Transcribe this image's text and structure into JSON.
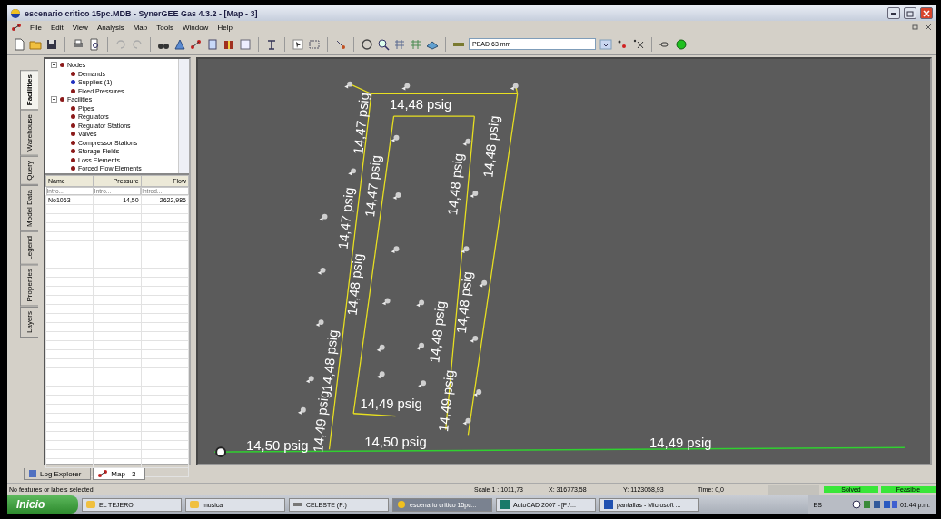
{
  "window": {
    "title": "escenario critico 15pc.MDB - SynerGEE Gas 4.3.2 - [Map - 3]"
  },
  "menu": [
    "File",
    "Edit",
    "View",
    "Analysis",
    "Map",
    "Tools",
    "Window",
    "Help"
  ],
  "toolbar": {
    "pipe_dropdown": "PEAD 63 mm"
  },
  "side_tabs": [
    {
      "label": "Facilities",
      "selected": true
    },
    {
      "label": "Warehouse",
      "selected": false
    },
    {
      "label": "Query",
      "selected": false
    },
    {
      "label": "Model Data",
      "selected": false
    },
    {
      "label": "Legend",
      "selected": false
    },
    {
      "label": "Properties",
      "selected": false
    },
    {
      "label": "Layers",
      "selected": false
    }
  ],
  "tree": [
    {
      "label": "Nodes",
      "color": "#8b1a1a",
      "expanded": true,
      "children": [
        {
          "label": "Demands",
          "color": "#8b1a1a"
        },
        {
          "label": "Supplies (1)",
          "color": "#2030c0"
        },
        {
          "label": "Fixed Pressures",
          "color": "#8b1a1a"
        }
      ]
    },
    {
      "label": "Facilities",
      "color": "#8b1a1a",
      "expanded": true,
      "children": [
        {
          "label": "Pipes",
          "color": "#8b1a1a"
        },
        {
          "label": "Regulators",
          "color": "#8b1a1a"
        },
        {
          "label": "Regulator Stations",
          "color": "#8b1a1a"
        },
        {
          "label": "Valves",
          "color": "#8b1a1a"
        },
        {
          "label": "Compressor Stations",
          "color": "#8b1a1a"
        },
        {
          "label": "Storage Fields",
          "color": "#8b1a1a"
        },
        {
          "label": "Loss Elements",
          "color": "#8b1a1a"
        },
        {
          "label": "Forced Flow Elements",
          "color": "#8b1a1a"
        }
      ]
    }
  ],
  "grid": {
    "columns": [
      {
        "label": "Name",
        "placeholder": "Intro..."
      },
      {
        "label": "Pressure",
        "placeholder": "Intro..."
      },
      {
        "label": "Flow",
        "placeholder": "Introd..."
      }
    ],
    "rows": [
      [
        "No1063",
        "14,50",
        "2622,986"
      ]
    ]
  },
  "map_labels": [
    {
      "text": "14,47 psig",
      "kind": "vertical"
    },
    {
      "text": "14,48 psig",
      "kind": "horizontal"
    },
    {
      "text": "14,47 psig",
      "kind": "vertical"
    },
    {
      "text": "14,48 psig",
      "kind": "vertical"
    },
    {
      "text": "14,48 psig",
      "kind": "vertical"
    },
    {
      "text": "14,47 psig",
      "kind": "vertical"
    },
    {
      "text": "14,48 psig",
      "kind": "vertical"
    },
    {
      "text": "14,48 psig",
      "kind": "vertical"
    },
    {
      "text": "14,48 psig",
      "kind": "vertical"
    },
    {
      "text": "14,48 psig",
      "kind": "vertical"
    },
    {
      "text": "14,49 psig",
      "kind": "horizontal"
    },
    {
      "text": "14,49 psig",
      "kind": "vertical"
    },
    {
      "text": "14,49 psig",
      "kind": "vertical"
    },
    {
      "text": "14,50 psig",
      "kind": "horizontal"
    },
    {
      "text": "14,50 psig",
      "kind": "horizontal"
    },
    {
      "text": "14,49 psig",
      "kind": "horizontal"
    }
  ],
  "bottom_tabs": [
    {
      "label": "Log Explorer",
      "selected": false
    },
    {
      "label": "Map - 3",
      "selected": true
    }
  ],
  "status_bar": {
    "message": "No features or labels selected",
    "panels": [
      {
        "text": "Scale 1 : 1011,73",
        "highlighted": false
      },
      {
        "text": "X: 316773,58",
        "highlighted": false
      },
      {
        "text": "Y: 1123058,93",
        "highlighted": false
      },
      {
        "text": "Time: 0,0",
        "highlighted": false
      },
      {
        "text": "Solved",
        "highlighted": true
      },
      {
        "text": "Feasible",
        "highlighted": true
      }
    ]
  },
  "taskbar": {
    "start": "Inicio",
    "items": [
      {
        "label": "EL TEJERO",
        "kind": "folder",
        "selected": false
      },
      {
        "label": "musica",
        "kind": "folder",
        "selected": false
      },
      {
        "label": "CELESTE (F:)",
        "kind": "drive",
        "selected": false
      },
      {
        "label": "escenario critico 15pc...",
        "kind": "app",
        "selected": true
      },
      {
        "label": "AutoCAD 2007 - [F:\\...",
        "kind": "cad",
        "selected": false
      },
      {
        "label": "pantallas - Microsoft ...",
        "kind": "doc",
        "selected": false
      }
    ],
    "language": "ES",
    "clock": "01:44 p.m."
  }
}
